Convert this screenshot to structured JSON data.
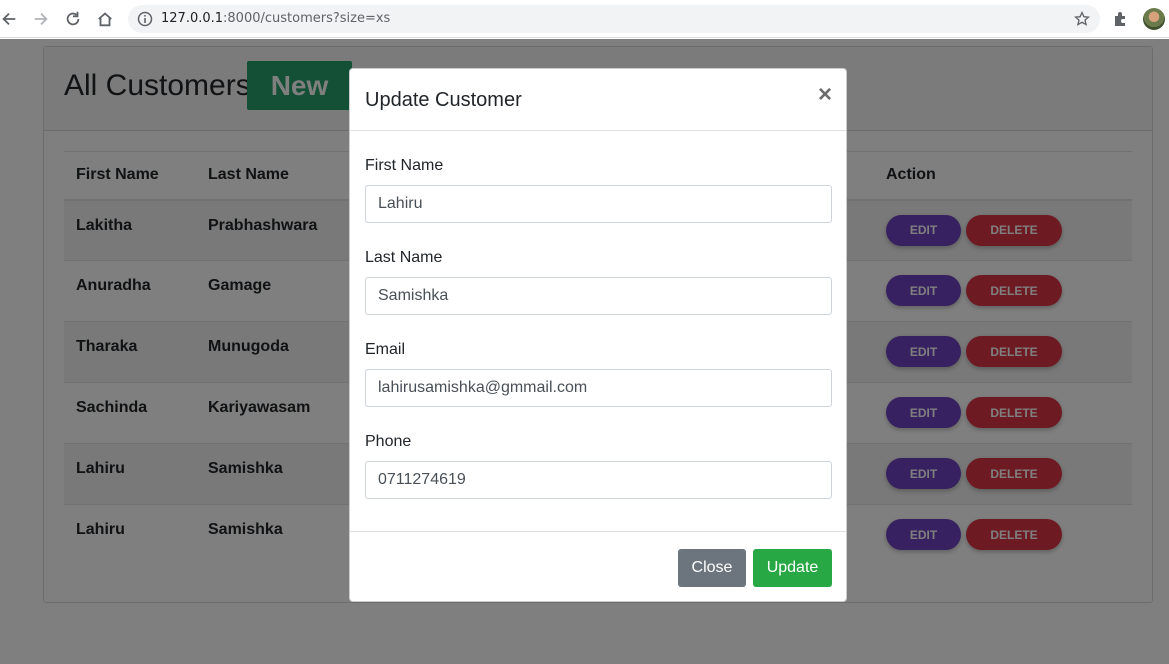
{
  "browser": {
    "url_host": "127.0.0.1",
    "url_rest": ":8000/customers?size=xs"
  },
  "page": {
    "title": "All Customers",
    "new_label": "New",
    "columns": [
      "First Name",
      "Last Name",
      "Action"
    ],
    "rows": [
      {
        "first": "Lakitha",
        "last": "Prabhashwara"
      },
      {
        "first": "Anuradha",
        "last": "Gamage"
      },
      {
        "first": "Tharaka",
        "last": "Munugoda"
      },
      {
        "first": "Sachinda",
        "last": "Kariyawasam"
      },
      {
        "first": "Lahiru",
        "last": "Samishka"
      },
      {
        "first": "Lahiru",
        "last": "Samishka"
      }
    ],
    "edit_label": "EDIT",
    "delete_label": "DELETE"
  },
  "modal": {
    "title": "Update Customer",
    "close_symbol": "×",
    "fields": [
      {
        "label": "First Name",
        "value": "Lahiru"
      },
      {
        "label": "Last Name",
        "value": "Samishka"
      },
      {
        "label": "Email",
        "value": "lahirusamishka@gmmail.com"
      },
      {
        "label": "Phone",
        "value": "0711274619"
      }
    ],
    "close_label": "Close",
    "update_label": "Update"
  }
}
